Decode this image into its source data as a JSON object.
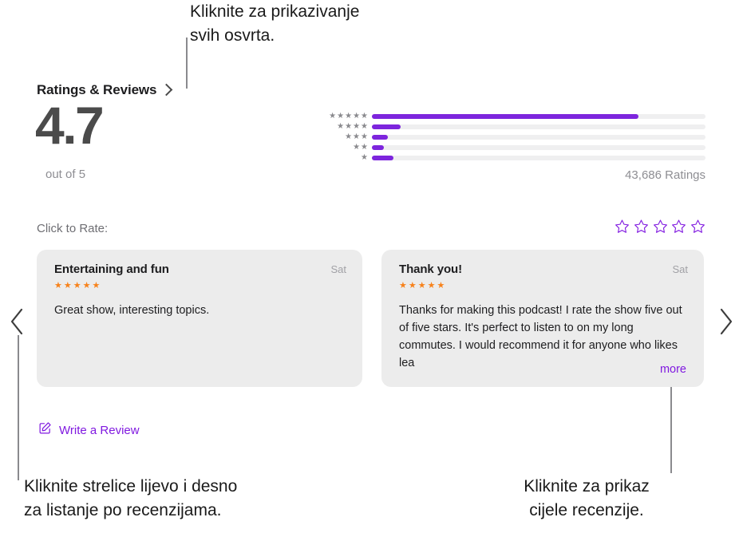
{
  "callouts": {
    "top": "Kliknite za prikazivanje\nsvih osvrta.",
    "bottom_left": "Kliknite strelice lijevo i desno\nza listanje po recenzijama.",
    "bottom_right": "Kliknite za prikaz\ncijele recenzije."
  },
  "section": {
    "title": "Ratings & Reviews",
    "disclosure_icon": "chevron-right-icon"
  },
  "summary": {
    "average": "4.7",
    "out_of": "out of 5",
    "ratings_count": "43,686 Ratings"
  },
  "histogram": {
    "rows": [
      {
        "stars": "★★★★★",
        "percent": 80
      },
      {
        "stars": "★★★★",
        "percent": 8.5
      },
      {
        "stars": "★★★",
        "percent": 4.8
      },
      {
        "stars": "★★",
        "percent": 3.6
      },
      {
        "stars": "★",
        "percent": 6.5
      }
    ]
  },
  "rate": {
    "label": "Click to Rate:",
    "star_count": 5,
    "star_icon": "star-outline-icon",
    "star_color": "#8019e0"
  },
  "reviews": [
    {
      "title": "Entertaining and fun",
      "date": "Sat",
      "stars": "★★★★★",
      "body": "Great show, interesting topics.",
      "truncated": false,
      "more_label": ""
    },
    {
      "title": "Thank you!",
      "date": "Sat",
      "stars": "★★★★★",
      "body": "Thanks for making this podcast! I rate the show five out of five stars. It's perfect to listen to on my long commutes. I would recommend it for anyone who likes lea",
      "truncated": true,
      "more_label": "more"
    }
  ],
  "write_review": {
    "label": "Write a Review",
    "icon": "compose-icon"
  },
  "nav": {
    "prev_icon": "chevron-left-icon",
    "next_icon": "chevron-right-icon"
  },
  "colors": {
    "accent_purple": "#7d25dd",
    "link_purple": "#8019e0",
    "star_orange": "#f7821b",
    "track_gray": "#efeff0",
    "card_gray": "#ececec"
  }
}
